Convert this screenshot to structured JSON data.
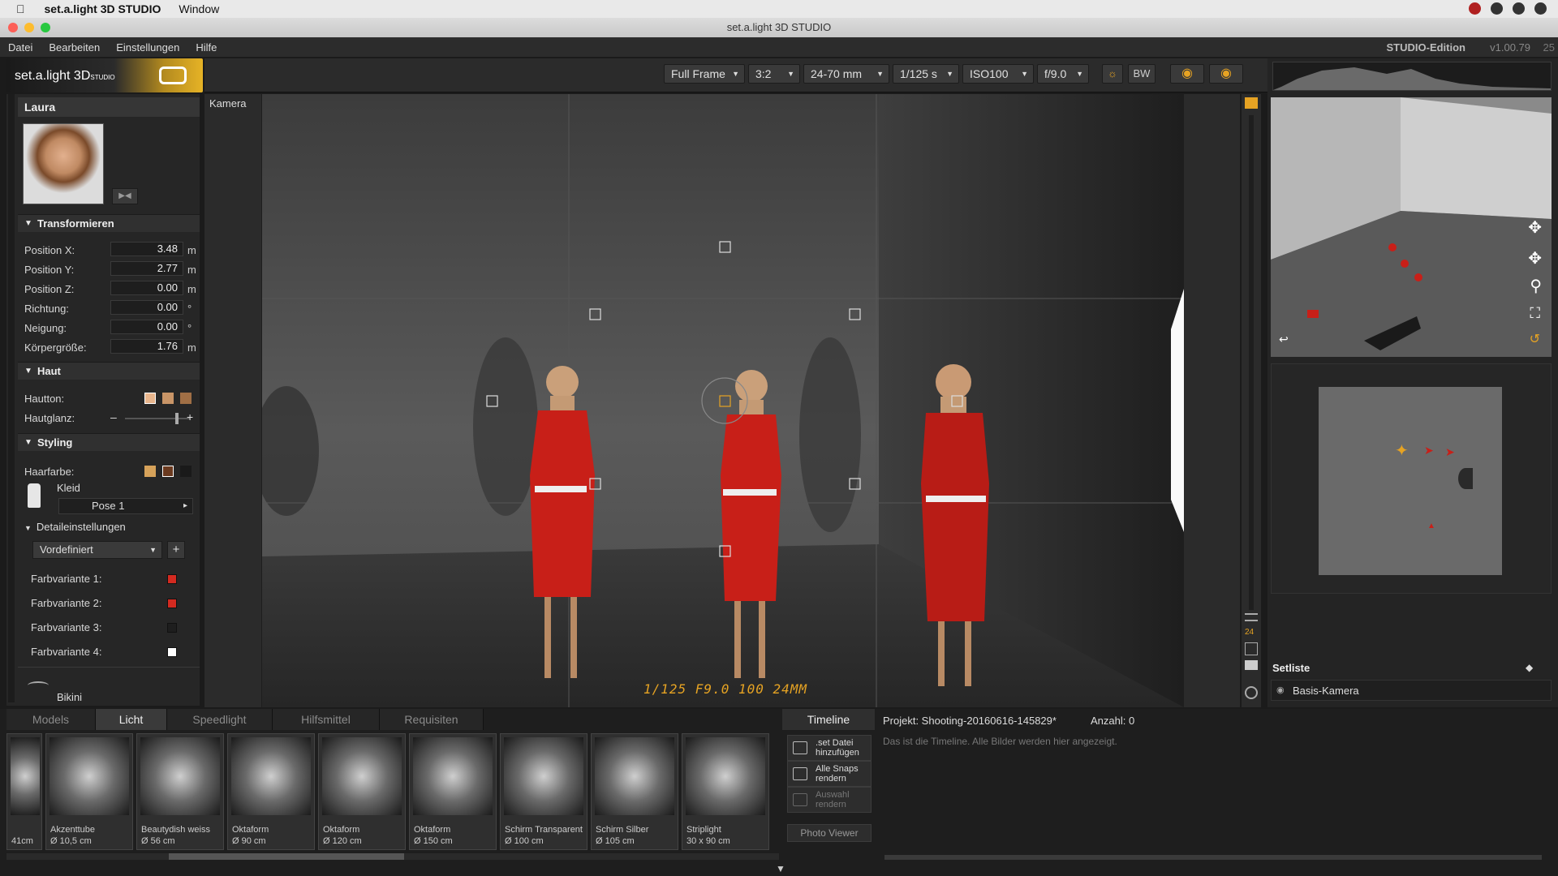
{
  "mac_menubar": {
    "apple": "",
    "app_name": "set.a.light 3D STUDIO",
    "window_menu": "Window"
  },
  "window": {
    "title": "set.a.light 3D STUDIO"
  },
  "app_menu": {
    "items": [
      "Datei",
      "Bearbeiten",
      "Einstellungen",
      "Hilfe"
    ],
    "edition": "STUDIO-Edition",
    "version": "v1.00.79",
    "version_extra": "25"
  },
  "logo": {
    "text": "set.a.light 3D",
    "superscript": "STUDIO"
  },
  "toolbar": {
    "sensor": "Full Frame",
    "aspect": "3:2",
    "lens": "24-70 mm",
    "shutter": "1/125 s",
    "iso": "ISO100",
    "aperture": "f/9.0",
    "bw_label": "BW"
  },
  "left_panel": {
    "model_name": "Laura",
    "transform": {
      "title": "Transformieren",
      "props": [
        {
          "label": "Position X:",
          "value": "3.48",
          "unit": "m"
        },
        {
          "label": "Position Y:",
          "value": "2.77",
          "unit": "m"
        },
        {
          "label": "Position Z:",
          "value": "0.00",
          "unit": "m"
        },
        {
          "label": "Richtung:",
          "value": "0.00",
          "unit": "°"
        },
        {
          "label": "Neigung:",
          "value": "0.00",
          "unit": "°"
        },
        {
          "label": "Körpergröße:",
          "value": "1.76",
          "unit": "m"
        }
      ]
    },
    "skin": {
      "title": "Haut",
      "tone_label": "Hautton:",
      "gloss_label": "Hautglanz:",
      "gloss_value": 0.82,
      "swatches": [
        "#e8b58c",
        "#c99567",
        "#a06f45"
      ]
    },
    "styling": {
      "title": "Styling",
      "hair_label": "Haarfarbe:",
      "hair_swatches": [
        "#d6a25a",
        "#6b3a1f",
        "#1a1a1a"
      ],
      "clothing": "Kleid",
      "pose": "Pose 1",
      "detail_title": "Detaileinstellungen",
      "preset": "Vordefiniert",
      "variants": [
        {
          "label": "Farbvariante 1:",
          "color": "#d32a20"
        },
        {
          "label": "Farbvariante 2:",
          "color": "#d32a20"
        },
        {
          "label": "Farbvariante 3:",
          "color": "#1e1e1e"
        },
        {
          "label": "Farbvariante 4:",
          "color": "#ffffff"
        }
      ],
      "next_item": "Bikini"
    }
  },
  "viewport": {
    "label": "Kamera",
    "exif": "1/125  F9.0  100  24MM"
  },
  "right_panel": {
    "setliste_title": "Setliste",
    "setliste_items": [
      "Basis-Kamera"
    ]
  },
  "bottom": {
    "tabs": [
      "Models",
      "Licht",
      "Speedlight",
      "Hilfsmittel",
      "Requisiten"
    ],
    "active_tab": "Licht",
    "thumbs": [
      {
        "name": "",
        "size": "41cm"
      },
      {
        "name": "Akzenttube",
        "size": "Ø 10,5 cm"
      },
      {
        "name": "Beautydish weiss",
        "size": "Ø 56 cm"
      },
      {
        "name": "Oktaform",
        "size": "Ø 90 cm"
      },
      {
        "name": "Oktaform",
        "size": "Ø 120 cm"
      },
      {
        "name": "Oktaform",
        "size": "Ø 150 cm"
      },
      {
        "name": "Schirm Transparent",
        "size": "Ø 100 cm"
      },
      {
        "name": "Schirm Silber",
        "size": "Ø 105 cm"
      },
      {
        "name": "Striplight",
        "size": "30 x 90 cm"
      }
    ],
    "timeline": {
      "title": "Timeline",
      "project": "Projekt: Shooting-20160616-145829*",
      "count": "Anzahl: 0",
      "empty_text": "Das ist die Timeline. Alle Bilder werden hier angezeigt.",
      "buttons": [
        {
          "line1": ".set Datei",
          "line2": "hinzufügen"
        },
        {
          "line1": "Alle Snaps",
          "line2": "rendern"
        },
        {
          "line1": "Auswahl",
          "line2": "rendern"
        }
      ],
      "photo_viewer": "Photo Viewer"
    }
  }
}
